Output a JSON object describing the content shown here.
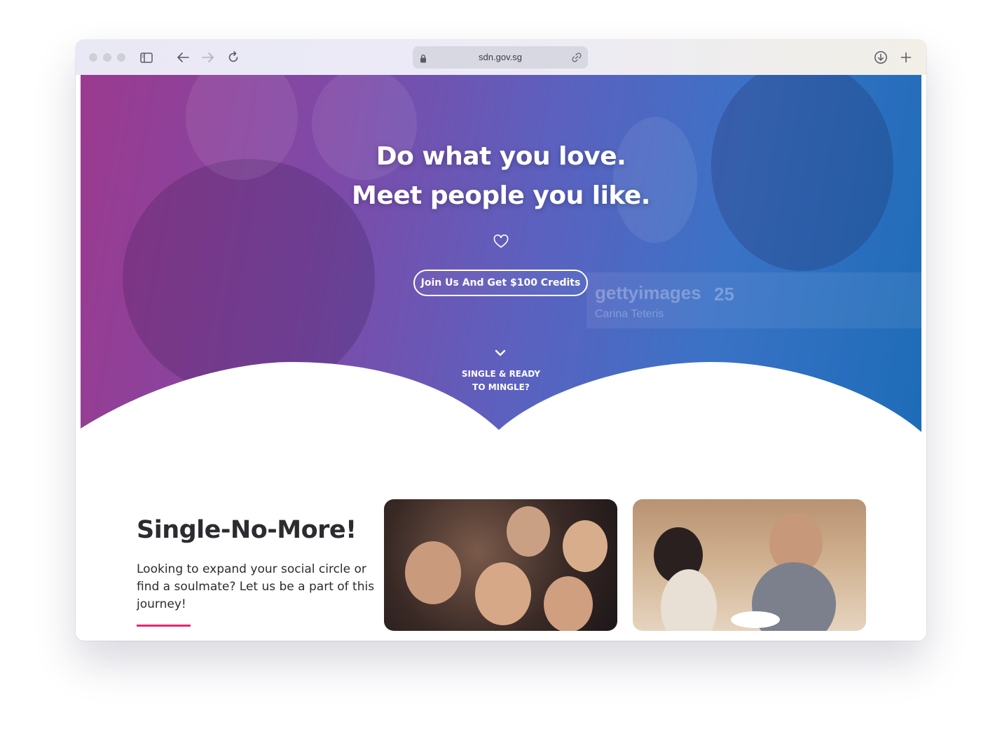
{
  "browser": {
    "url": "sdn.gov.sg"
  },
  "hero": {
    "headline_line1": "Do what you love.",
    "headline_line2": "Meet people you like.",
    "cta_label": "Join Us And Get $100 Credits",
    "scroll_label_line1": "SINGLE & READY",
    "scroll_label_line2": "TO MINGLE?",
    "watermark_brand": "gettyimages",
    "watermark_years": "25",
    "watermark_credit": "Carina Teteris"
  },
  "intro": {
    "title": "Single-No-More!",
    "text": "Looking to expand your social circle or find a soulmate? Let us be a part of this journey!"
  },
  "colors": {
    "accent": "#e8256f",
    "hero_start": "#9b3a8f",
    "hero_end": "#1d6cb8"
  },
  "icons": [
    "sidebar-icon",
    "back-arrow-icon",
    "forward-arrow-icon",
    "reload-icon",
    "lock-icon",
    "link-icon",
    "download-icon",
    "new-tab-icon",
    "heart-icon",
    "chevron-down-icon"
  ]
}
